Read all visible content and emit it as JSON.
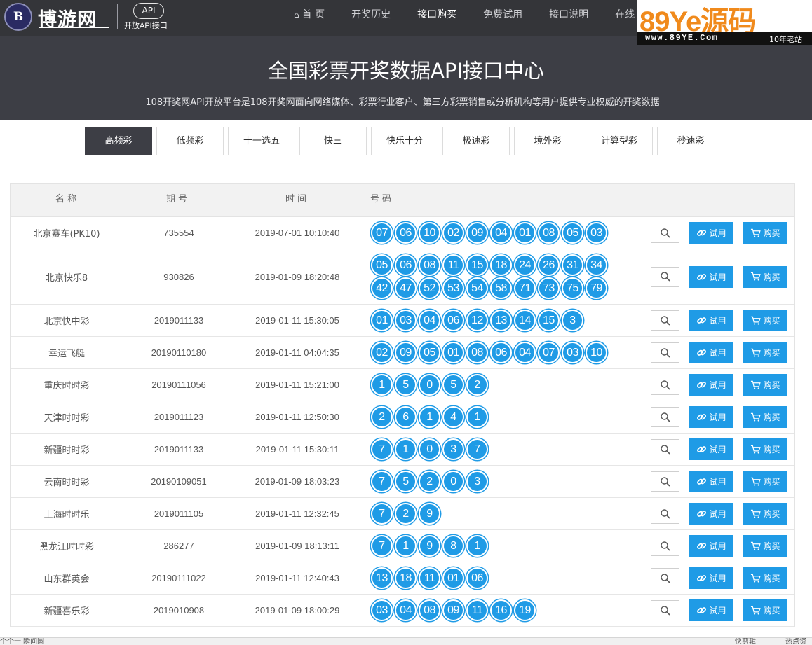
{
  "logo": {
    "badge": "B",
    "name": "博游网",
    "api_badge": "API",
    "api_sub": "开放API接口"
  },
  "nav": [
    {
      "label": "首 页",
      "icon": "home-icon",
      "active": false
    },
    {
      "label": "开奖历史",
      "active": false
    },
    {
      "label": "接口购买",
      "active": true
    },
    {
      "label": "免费试用",
      "active": false
    },
    {
      "label": "接口说明",
      "active": false
    },
    {
      "label": "在线",
      "active": false
    }
  ],
  "watermark": {
    "title": "89Ye源码",
    "site": "www.89YE.Com",
    "tag": "10年老站"
  },
  "hero": {
    "title": "全国彩票开奖数据API接口中心",
    "desc": "108开奖网API开放平台是108开奖网面向网络媒体、彩票行业客户、第三方彩票销售或分析机构等用户提供专业权威的开奖数据"
  },
  "tabs": [
    "高频彩",
    "低频彩",
    "十一选五",
    "快三",
    "快乐十分",
    "极速彩",
    "境外彩",
    "计算型彩",
    "秒速彩"
  ],
  "active_tab": 0,
  "table": {
    "headers": {
      "name": "名称",
      "issue": "期号",
      "time": "时间",
      "balls": "号码"
    },
    "try_label": "试用",
    "buy_label": "购买",
    "rows": [
      {
        "name": "北京赛车(PK10)",
        "issue": "735554",
        "time": "2019-07-01 10:10:40",
        "balls": [
          "07",
          "06",
          "10",
          "02",
          "09",
          "04",
          "01",
          "08",
          "05",
          "03"
        ]
      },
      {
        "name": "北京快乐8",
        "issue": "930826",
        "time": "2019-01-09 18:20:48",
        "balls": [
          "05",
          "06",
          "08",
          "11",
          "15",
          "18",
          "24",
          "26",
          "31",
          "34",
          "42",
          "47",
          "52",
          "53",
          "54",
          "58",
          "71",
          "73",
          "75",
          "79"
        ]
      },
      {
        "name": "北京快中彩",
        "issue": "2019011133",
        "time": "2019-01-11 15:30:05",
        "balls": [
          "01",
          "03",
          "04",
          "06",
          "12",
          "13",
          "14",
          "15",
          "3"
        ]
      },
      {
        "name": "幸运飞艇",
        "issue": "20190110180",
        "time": "2019-01-11 04:04:35",
        "balls": [
          "02",
          "09",
          "05",
          "01",
          "08",
          "06",
          "04",
          "07",
          "03",
          "10"
        ]
      },
      {
        "name": "重庆时时彩",
        "issue": "20190111056",
        "time": "2019-01-11 15:21:00",
        "balls": [
          "1",
          "5",
          "0",
          "5",
          "2"
        ]
      },
      {
        "name": "天津时时彩",
        "issue": "2019011123",
        "time": "2019-01-11 12:50:30",
        "balls": [
          "2",
          "6",
          "1",
          "4",
          "1"
        ]
      },
      {
        "name": "新疆时时彩",
        "issue": "2019011133",
        "time": "2019-01-11 15:30:11",
        "balls": [
          "7",
          "1",
          "0",
          "3",
          "7"
        ]
      },
      {
        "name": "云南时时彩",
        "issue": "20190109051",
        "time": "2019-01-09 18:03:23",
        "balls": [
          "7",
          "5",
          "2",
          "0",
          "3"
        ]
      },
      {
        "name": "上海时时乐",
        "issue": "2019011105",
        "time": "2019-01-11 12:32:45",
        "balls": [
          "7",
          "2",
          "9"
        ]
      },
      {
        "name": "黑龙江时时彩",
        "issue": "286277",
        "time": "2019-01-09 18:13:11",
        "balls": [
          "7",
          "1",
          "9",
          "8",
          "1"
        ]
      },
      {
        "name": "山东群英会",
        "issue": "20190111022",
        "time": "2019-01-11 12:40:43",
        "balls": [
          "13",
          "18",
          "11",
          "01",
          "06"
        ]
      },
      {
        "name": "新疆喜乐彩",
        "issue": "2019010908",
        "time": "2019-01-09 18:00:29",
        "balls": [
          "03",
          "04",
          "08",
          "09",
          "11",
          "16",
          "19"
        ]
      }
    ]
  },
  "statusbar": {
    "left": "个个一  瞬间圆",
    "right1": "快剪辑",
    "right2": "热点资"
  },
  "colors": {
    "header_bg": "#3d3e45",
    "accent": "#1f9be6",
    "watermark_orange": "#f08a1c"
  }
}
